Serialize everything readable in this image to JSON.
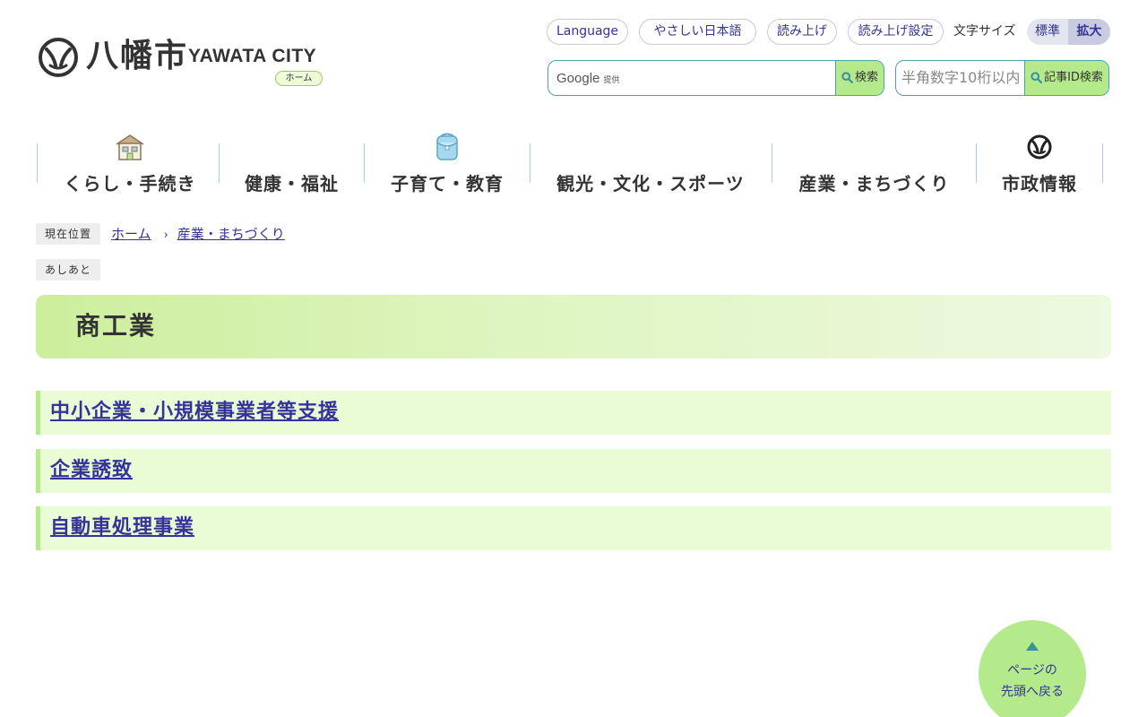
{
  "header": {
    "logo_kanji": "八幡市",
    "logo_en": "YAWATA CITY",
    "home_badge": "ホーム",
    "links": {
      "language": "Language",
      "easy_japanese": "やさしい日本語",
      "read_aloud": "読み上げ",
      "read_aloud_settings": "読み上げ設定"
    },
    "font_size": {
      "label": "文字サイズ",
      "standard": "標準",
      "large": "拡大",
      "selected": "拡大"
    },
    "site_search": {
      "provider": "Google",
      "provided_label": "提供",
      "value": "",
      "button": "検索"
    },
    "id_search": {
      "placeholder": "半角数字10桁以内",
      "button": "記事ID検索"
    }
  },
  "nav": {
    "items": [
      {
        "label": "くらし・手続き",
        "icon": "house-icon"
      },
      {
        "label": "健康・福祉",
        "icon": ""
      },
      {
        "label": "子育て・教育",
        "icon": "school-bag-icon"
      },
      {
        "label": "観光・文化・スポーツ",
        "icon": ""
      },
      {
        "label": "産業・まちづくり",
        "icon": ""
      },
      {
        "label": "市政情報",
        "icon": "city-emblem-icon"
      }
    ]
  },
  "breadcrumb": {
    "current_label": "現在位置",
    "items": [
      "ホーム",
      "産業・まちづくり"
    ],
    "history_label": "あしあと"
  },
  "page": {
    "title": "商工業",
    "categories": [
      "中小企業・小規模事業者等支援",
      "企業誘致",
      "自動車処理事業"
    ]
  },
  "back_to_top": {
    "line1": "ページの",
    "line2": "先頭へ戻る"
  },
  "colors": {
    "accent_green": "#b5ea8c",
    "link_blue": "#333399",
    "border_teal": "#4da3a3"
  }
}
